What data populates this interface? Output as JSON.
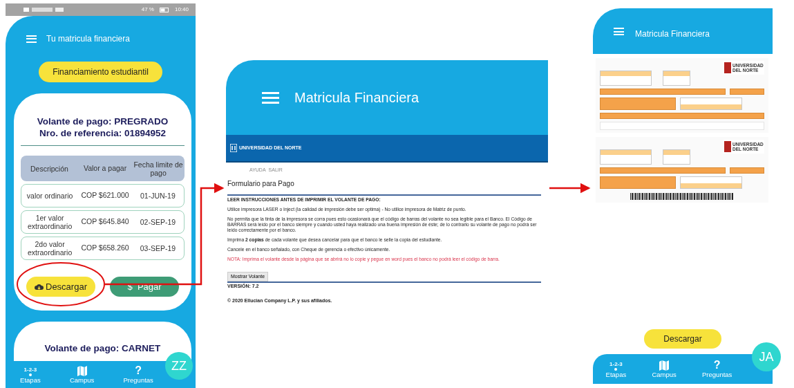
{
  "left_phone": {
    "status_bar": {
      "battery": "47 %",
      "time": "10:40"
    },
    "header": {
      "title": "Tu matricula financiera"
    },
    "financing_button": "Financiamiento estudiantil",
    "payment_card": {
      "title": "Volante de pago: PREGRADO",
      "reference": "Nro. de referencia: 01894952",
      "table": {
        "columns": [
          "Descripción",
          "Valor a pagar",
          "Fecha limite de pago"
        ],
        "rows": [
          [
            "valor ordinario",
            "COP $621.000",
            "01-JUN-19"
          ],
          [
            "1er valor extraordinario",
            "COP $645.840",
            "02-SEP-19"
          ],
          [
            "2do valor extraordinario",
            "COP $658.260",
            "03-SEP-19"
          ]
        ]
      },
      "buttons": [
        {
          "kind": "download",
          "label": "Descargar"
        },
        {
          "kind": "pay",
          "glyph": "$",
          "label": "Pagar"
        }
      ]
    },
    "next_card": {
      "title": "Volante de pago: CARNET"
    },
    "bottom_nav": [
      {
        "kind": "text",
        "glyph": "1-2-3",
        "label": "Etapas"
      },
      {
        "kind": "map",
        "label": "Campus"
      },
      {
        "kind": "text",
        "glyph": "?",
        "label": "Preguntas"
      }
    ],
    "avatar": "ZZ"
  },
  "web_page": {
    "header": {
      "title": "Matricula Financiera"
    },
    "banner": {
      "logo_text": "UNIVERSIDAD DEL NORTE"
    },
    "links": [
      "AYUDA",
      "SALIR"
    ],
    "form_title": "Formulario para Pago",
    "paragraphs": [
      {
        "kind": "heading",
        "text": "LEER INSTRUCCIONES ANTES DE IMPRIMIR EL VOLANTE DE PAGO:"
      },
      {
        "kind": "text",
        "text": "Utilice impresora LASER o Inject (la calidad de impresión debe ser optima) - No utilice impresora de Matriz de punto."
      },
      {
        "kind": "text",
        "text": "No permita que la tinta de la impresora se corra pues esto ocasionará que el código de barras del volante no sea legible para el Banco. El Código de BARRAS será leído por el banco siempre y cuando usted haya realizado una buena impresión de éste; de lo contrario su volante de pago no podrá ser leído correctamente por el banco."
      },
      {
        "kind": "text",
        "text": "Imprima **2 copias** de cada volante que desea cancelar para que el banco le selle la copia del estudiante."
      },
      {
        "kind": "text",
        "text": "Cancele en el banco señalado, con Cheque de gerencia o efectivo únicamente."
      },
      {
        "kind": "note",
        "text": "NOTA: Imprima el volante desde la página que se abrirá no lo copie y pegue en word pues el banco no podrá leer el código de barra."
      }
    ],
    "button": "Mostrar Volante",
    "version": "VERSIÓN: 7.2",
    "copyright": "© 2020 Ellucian Company L.P. y sus afiliados."
  },
  "right_phone": {
    "header": {
      "title": "Matricula Financiera"
    },
    "vouchers": [
      {
        "logo_text": "UNIVERSIDAD DEL NORTE",
        "barcode": false
      },
      {
        "logo_text": "UNIVERSIDAD DEL NORTE",
        "barcode": true
      }
    ],
    "download_button": "Descargar",
    "bottom_nav": [
      {
        "kind": "text",
        "glyph": "1-2-3",
        "label": "Etapas"
      },
      {
        "kind": "map",
        "label": "Campus"
      },
      {
        "kind": "text",
        "glyph": "?",
        "label": "Preguntas"
      }
    ],
    "avatar": "JA"
  }
}
